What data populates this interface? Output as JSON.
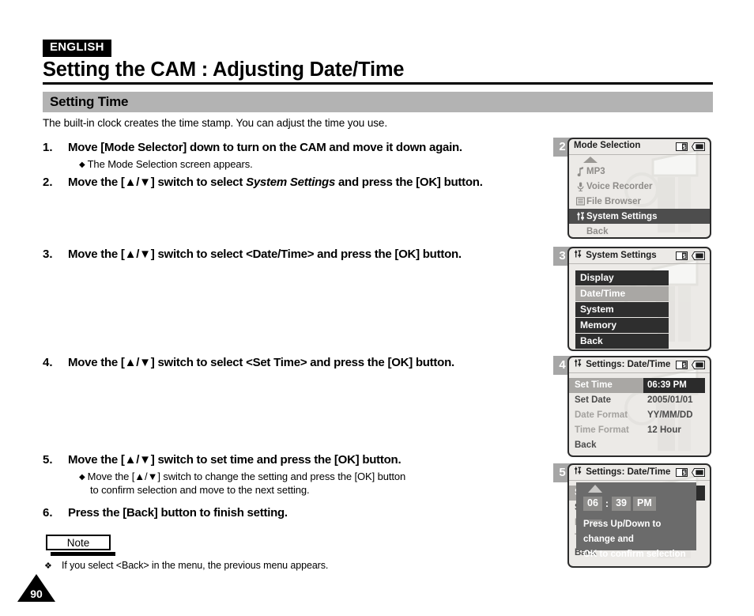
{
  "header": {
    "language_badge": "ENGLISH",
    "title": "Setting the CAM : Adjusting Date/Time",
    "section_title": "Setting Time"
  },
  "intro": "The built-in clock creates the time stamp. You can adjust the time you use.",
  "steps": [
    {
      "number": "1.",
      "head_prefix": "Move [Mode Selector] down to turn on the CAM and move it down again.",
      "head_italic": "",
      "head_suffix": "",
      "sub": "The Mode Selection screen appears."
    },
    {
      "number": "2.",
      "head_prefix": "Move the [▲/▼] switch to select ",
      "head_italic": "System Settings",
      "head_suffix": " and press the [OK] button."
    },
    {
      "number": "3.",
      "head_prefix": "Move the [▲/▼] switch to select <Date/Time> and press the [OK] button.",
      "head_italic": "",
      "head_suffix": ""
    },
    {
      "number": "4.",
      "head_prefix": "Move the [▲/▼] switch to select <Set Time> and press the [OK] button.",
      "head_italic": "",
      "head_suffix": ""
    },
    {
      "number": "5.",
      "head_prefix": "Move the [▲/▼] switch to set time and press the [OK] button.",
      "head_italic": "",
      "head_suffix": "",
      "sub": "Move the [▲/▼] switch to change the setting and press the [OK] button",
      "sub_cont": "to confirm selection and move to the next setting."
    },
    {
      "number": "6.",
      "head_prefix": "Press the [Back] button to finish setting.",
      "head_italic": "",
      "head_suffix": ""
    }
  ],
  "note": {
    "box_label": "Note",
    "bullet_mark": "❖",
    "text": "If you select <Back> in the menu, the previous menu appears."
  },
  "page_number": "90",
  "panels": [
    {
      "badge": "2",
      "title": "Mode Selection",
      "title_icon": "",
      "status_icons": [
        "memory-card-icon",
        "battery-icon"
      ],
      "type": "mode-list",
      "items": [
        {
          "label": "MP3",
          "icon": "music-note-icon",
          "state": "normal"
        },
        {
          "label": "Voice Recorder",
          "icon": "microphone-icon",
          "state": "normal"
        },
        {
          "label": "File Browser",
          "icon": "document-icon",
          "state": "normal"
        },
        {
          "label": "System Settings",
          "icon": "sliders-icon",
          "state": "selected"
        },
        {
          "label": "Back",
          "icon": "",
          "state": "normal"
        }
      ]
    },
    {
      "badge": "3",
      "title": "System Settings",
      "title_icon": "sliders-icon",
      "status_icons": [
        "memory-card-icon",
        "battery-icon"
      ],
      "type": "block-list",
      "items": [
        {
          "label": "Display",
          "state": "normal"
        },
        {
          "label": "Date/Time",
          "state": "selected"
        },
        {
          "label": "System",
          "state": "normal"
        },
        {
          "label": "Memory",
          "state": "normal"
        },
        {
          "label": "Back",
          "state": "normal"
        }
      ]
    },
    {
      "badge": "4",
      "title": "Settings: Date/Time",
      "title_icon": "sliders-icon",
      "status_icons": [
        "memory-card-icon",
        "battery-icon"
      ],
      "type": "kv-list",
      "rows": [
        {
          "key": "Set Time",
          "value": "06:39 PM",
          "state": "selected"
        },
        {
          "key": "Set Date",
          "value": "2005/01/01",
          "state": "normal"
        },
        {
          "key": "Date Format",
          "value": "YY/MM/DD",
          "state": "dim"
        },
        {
          "key": "Time Format",
          "value": "12 Hour",
          "state": "dim"
        },
        {
          "key": "Back",
          "value": "",
          "state": "normal"
        }
      ]
    },
    {
      "badge": "5",
      "title": "Settings: Date/Time",
      "title_icon": "sliders-icon",
      "status_icons": [
        "memory-card-icon",
        "battery-icon"
      ],
      "type": "kv-list-overlay",
      "rows": [
        {
          "key": "Set Time",
          "value": "",
          "state": "selected"
        },
        {
          "key": "Set Date",
          "value": "",
          "state": "normal"
        },
        {
          "key": "Date Format",
          "value": "",
          "state": "dim"
        },
        {
          "key": "Time Format",
          "value": "",
          "state": "dim"
        },
        {
          "key": "Back",
          "value": "",
          "state": "normal"
        }
      ],
      "dialog": {
        "hour": "06",
        "separator": ":",
        "minute": "39",
        "meridiem": "PM",
        "message_line1": "Press Up/Down to change and",
        "message_line2": "OK to confirm selection"
      }
    }
  ],
  "colors": {
    "section_bar": "#b3b3b3",
    "lcd_bg": "#eceae7",
    "selected_dark": "#4d4d4d",
    "block_dark": "#2e2e2e",
    "highlight_gray": "#a9a7a4",
    "dialog_bg": "#6b6b6b"
  }
}
